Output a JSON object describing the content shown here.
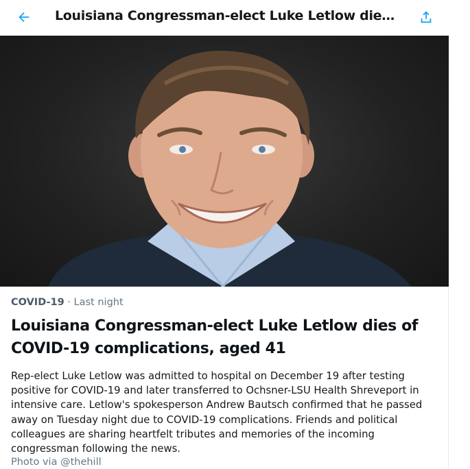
{
  "header": {
    "title": "Louisiana Congressman-elect Luke Letlow dies...",
    "back_icon": "arrow-left-icon",
    "share_icon": "share-icon",
    "accent_color": "#1da1f2"
  },
  "article": {
    "category": "COVID-19",
    "separator": " · ",
    "timestamp": "Last night",
    "headline": "Louisiana Congressman-elect Luke Letlow dies of COVID-19 complications, aged 41",
    "summary": "Rep-elect Luke Letlow was admitted to hospital on December 19 after testing positive for COVID-19 and later transferred to Ochsner-LSU Health Shreveport in intensive care. Letlow's spokesperson Andrew Bautsch confirmed that he passed away on Tuesday night due to COVID-19 complications. Friends and political colleagues are sharing heartfelt tributes and memories of the incoming congressman following the news.",
    "photo_credit": "Photo via @thehill"
  }
}
